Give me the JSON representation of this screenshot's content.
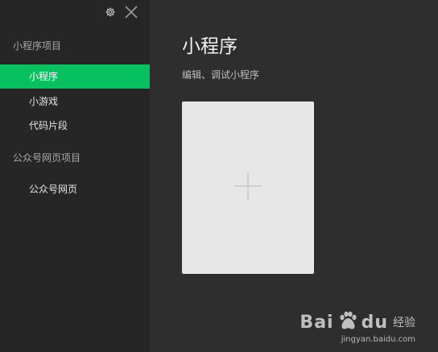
{
  "sidebar": {
    "toolbar": {
      "settings_icon": "gear-icon",
      "close_icon": "close-icon"
    },
    "groups": [
      {
        "title": "小程序项目",
        "items": [
          {
            "label": "小程序",
            "active": true
          },
          {
            "label": "小游戏",
            "active": false
          },
          {
            "label": "代码片段",
            "active": false
          }
        ]
      },
      {
        "title": "公众号网页项目",
        "items": [
          {
            "label": "公众号网页",
            "active": false
          }
        ]
      }
    ]
  },
  "main": {
    "title": "小程序",
    "subtitle": "编辑、调试小程序",
    "create_card": {
      "icon": "plus-icon"
    }
  },
  "watermark": {
    "brand": "Bai",
    "brand_end": "du",
    "suffix": "经验",
    "url": "jingyan.baidu.com"
  },
  "colors": {
    "accent": "#07c160",
    "sidebar_bg": "#262626",
    "main_bg": "#2e2e2e",
    "card_bg": "#e7e7e7"
  }
}
